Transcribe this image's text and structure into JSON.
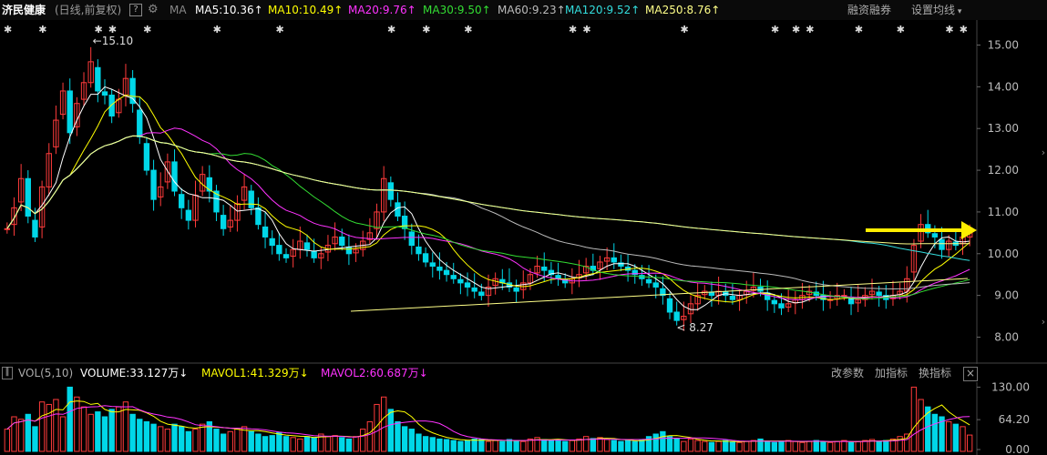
{
  "header": {
    "stock_name": "济民健康",
    "period": "(日线,前复权)",
    "help_icon": "?",
    "settings_icon": "gear-icon",
    "ma_label": "MA",
    "ma_items": [
      {
        "text": "MA5:10.36",
        "color": "#ffffff"
      },
      {
        "text": "MA10:10.49",
        "color": "#ffff00"
      },
      {
        "text": "MA20:9.76",
        "color": "#ff33ff"
      },
      {
        "text": "MA30:9.50",
        "color": "#33dd33"
      },
      {
        "text": "MA60:9.23",
        "color": "#bbbbbb"
      },
      {
        "text": "MA120:9.52",
        "color": "#33dddd"
      },
      {
        "text": "MA250:8.76",
        "color": "#ffff88"
      }
    ],
    "arrow_up": "↑",
    "financing_btn": "融资融券",
    "set_ma_btn": "设置均线"
  },
  "volume_bar": {
    "label": "VOL(5,10)",
    "volume": "VOLUME:33.127万",
    "mavol1": "MAVOL1:41.329万",
    "mavol2": "MAVOL2:60.687万",
    "arrow_down": "↓",
    "change_params": "改参数",
    "add_indicator": "加指标",
    "switch_indicator": "换指标",
    "close": "×"
  },
  "annotations": {
    "high": "15.10",
    "low": "8.27"
  },
  "colors": {
    "up": "#ff3b3b",
    "down": "#00d7e8",
    "ma5": "#ffffff",
    "ma10": "#ffff00",
    "ma20": "#ff33ff",
    "ma30": "#33dd33",
    "ma60": "#bbbbbb",
    "ma120": "#33dddd",
    "ma250": "#ffff88",
    "arrow": "#ffee00"
  },
  "chart_data": {
    "type": "candlestick",
    "ylim": [
      7.4,
      15.6
    ],
    "y_ticks": [
      "15.00",
      "14.00",
      "13.00",
      "12.00",
      "11.00",
      "10.00",
      "9.00",
      "8.00"
    ],
    "vol_ticks": [
      "130.00",
      "64.20",
      "0.00"
    ],
    "vol_ylim": [
      0,
      140
    ],
    "closes": [
      10.6,
      11.1,
      11.8,
      10.9,
      10.4,
      11.6,
      12.4,
      13.2,
      13.9,
      12.9,
      13.6,
      14.1,
      14.6,
      13.9,
      13.8,
      13.3,
      13.7,
      14.2,
      13.6,
      12.8,
      12.0,
      11.3,
      11.6,
      12.2,
      11.5,
      11.1,
      10.8,
      11.4,
      11.9,
      11.5,
      11.0,
      10.6,
      10.8,
      11.2,
      11.6,
      11.1,
      10.7,
      10.4,
      10.2,
      10.0,
      9.9,
      10.1,
      10.3,
      10.1,
      9.9,
      10.0,
      10.2,
      10.4,
      10.2,
      10.0,
      10.1,
      10.3,
      10.5,
      11.0,
      11.8,
      11.3,
      10.9,
      10.6,
      10.2,
      10.0,
      9.8,
      9.7,
      9.6,
      9.5,
      9.4,
      9.3,
      9.2,
      9.1,
      9.0,
      9.2,
      9.4,
      9.3,
      9.2,
      9.1,
      9.3,
      9.5,
      9.7,
      9.6,
      9.5,
      9.4,
      9.3,
      9.4,
      9.5,
      9.7,
      9.6,
      9.8,
      9.9,
      9.8,
      9.7,
      9.6,
      9.5,
      9.4,
      9.3,
      9.2,
      9.0,
      8.6,
      8.4,
      8.5,
      8.8,
      9.0,
      9.1,
      9.0,
      9.1,
      9.0,
      8.9,
      9.0,
      9.1,
      9.2,
      9.1,
      8.9,
      8.8,
      8.7,
      8.8,
      8.9,
      9.0,
      9.1,
      9.0,
      8.9,
      8.9,
      9.0,
      9.0,
      8.8,
      8.9,
      9.0,
      9.1,
      9.0,
      8.9,
      9.0,
      9.1,
      9.4,
      10.2,
      10.7,
      10.5,
      10.4,
      10.1,
      10.3,
      10.2,
      10.4,
      10.5
    ],
    "volumes": [
      45,
      70,
      65,
      75,
      50,
      100,
      95,
      105,
      70,
      130,
      110,
      90,
      75,
      80,
      70,
      85,
      90,
      100,
      75,
      65,
      60,
      55,
      50,
      45,
      55,
      50,
      40,
      45,
      55,
      60,
      45,
      35,
      40,
      45,
      50,
      40,
      35,
      30,
      32,
      38,
      30,
      28,
      25,
      30,
      28,
      35,
      30,
      32,
      28,
      25,
      30,
      45,
      60,
      95,
      110,
      85,
      60,
      50,
      45,
      35,
      30,
      28,
      25,
      24,
      22,
      20,
      22,
      25,
      24,
      20,
      22,
      20,
      24,
      22,
      20,
      25,
      28,
      24,
      22,
      24,
      20,
      22,
      25,
      30,
      26,
      28,
      24,
      22,
      20,
      22,
      20,
      24,
      30,
      35,
      40,
      30,
      25,
      20,
      25,
      22,
      20,
      18,
      20,
      22,
      20,
      18,
      20,
      22,
      25,
      20,
      18,
      20,
      22,
      20,
      18,
      20,
      22,
      20,
      18,
      20,
      22,
      18,
      20,
      22,
      24,
      20,
      22,
      25,
      30,
      35,
      130,
      105,
      90,
      75,
      70,
      60,
      55,
      50,
      33
    ]
  }
}
